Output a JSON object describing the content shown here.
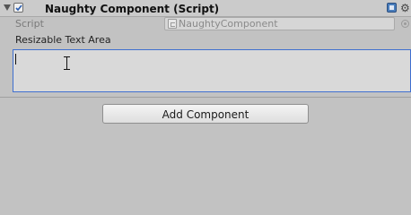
{
  "component": {
    "title": "Naughty Component (Script)",
    "enabled": true,
    "icons": {
      "foldout": "foldout-triangle-icon",
      "help": "help-book-icon",
      "settings": "gear-icon"
    }
  },
  "fields": {
    "script": {
      "label": "Script",
      "value": "NaughtyComponent",
      "icon": "cs-script-icon"
    },
    "resizable_text_area": {
      "label": "Resizable Text Area",
      "value": ""
    }
  },
  "add_component": {
    "label": "Add Component"
  },
  "colors": {
    "background": "#c2c2c2",
    "focus_border": "#3f6fd0",
    "help_icon": "#4a7ebc"
  }
}
